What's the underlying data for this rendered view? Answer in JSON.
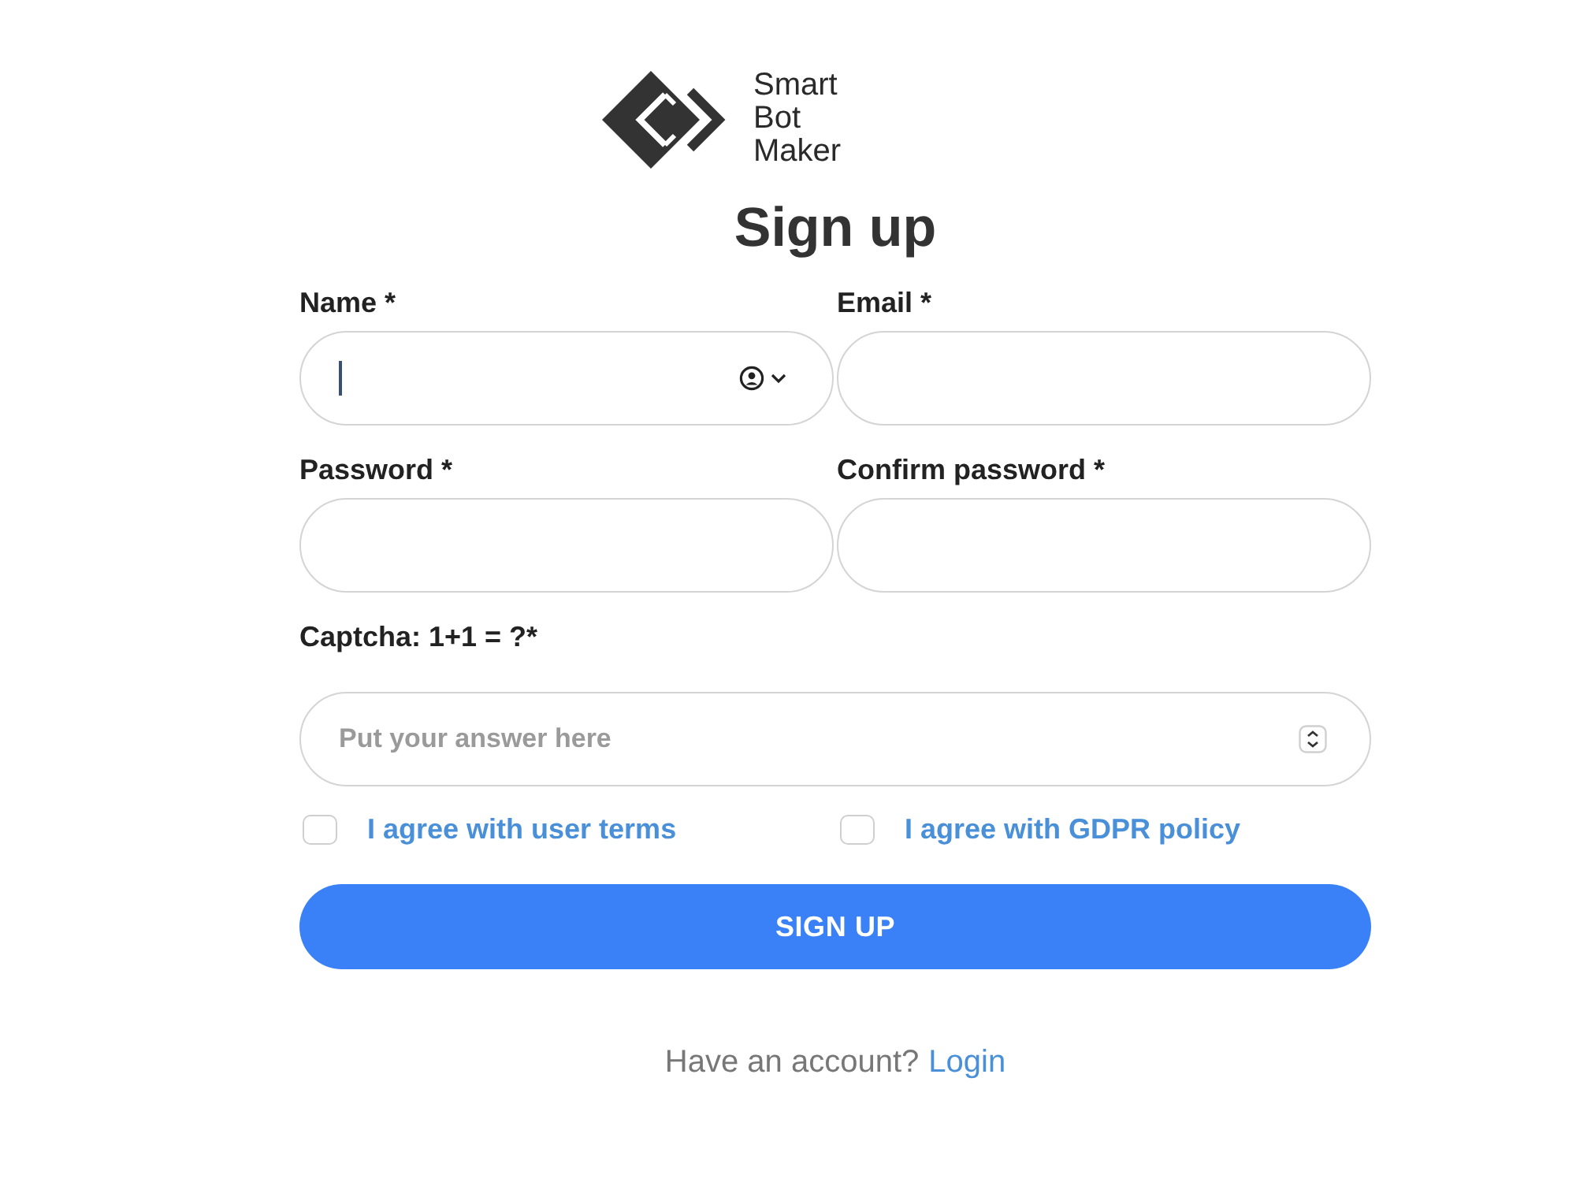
{
  "logo": {
    "lines": [
      "Smart",
      "Bot",
      "Maker"
    ]
  },
  "title": "Sign up",
  "fields": [
    {
      "label": "Name *",
      "kind": "autofill",
      "focused": true
    },
    {
      "label": "Email *",
      "kind": "text",
      "focused": false
    },
    {
      "label": "Password *",
      "kind": "text",
      "focused": false
    },
    {
      "label": "Confirm password *",
      "kind": "text",
      "focused": false
    }
  ],
  "captcha": {
    "label": "Captcha: 1+1 = ?*",
    "placeholder": "Put your answer here",
    "kind": "number",
    "focused": false
  },
  "agreements": [
    {
      "label": "I agree with user terms",
      "checked": false
    },
    {
      "label": "I agree with GDPR policy",
      "checked": false
    }
  ],
  "button": "SIGN UP",
  "footer": {
    "text": "Have an account?",
    "link": "Login"
  }
}
